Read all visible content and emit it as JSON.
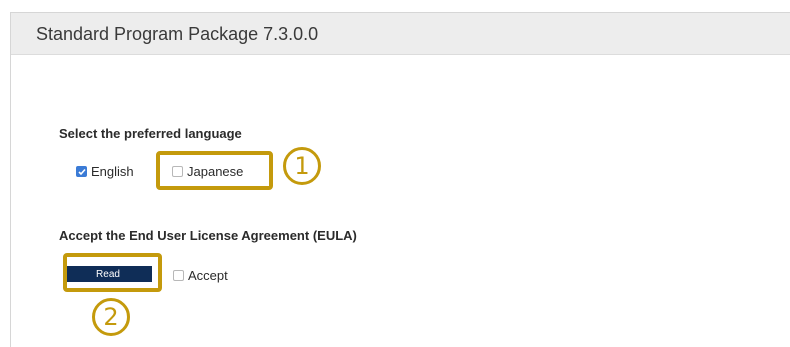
{
  "window": {
    "title": "Standard Program Package 7.3.0.0"
  },
  "language_section": {
    "heading": "Select the preferred language",
    "options": [
      {
        "label": "English",
        "checked": true
      },
      {
        "label": "Japanese",
        "checked": false
      }
    ]
  },
  "eula_section": {
    "heading": "Accept the End User License Agreement (EULA)",
    "read_button_label": "Read",
    "accept_label": "Accept",
    "accept_checked": false
  },
  "annotations": {
    "marker_1": "1",
    "marker_2": "2"
  },
  "colors": {
    "highlight": "#c49a0c",
    "button": "#0f2d57",
    "checkbox_checked": "#3b7bd6",
    "titlebar": "#ededed"
  }
}
